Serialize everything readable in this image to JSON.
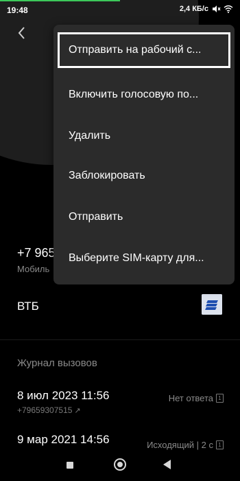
{
  "status_bar": {
    "time": "19:48",
    "speed": "2,4 КБ/с",
    "icons": [
      "mute-icon",
      "wifi-icon"
    ]
  },
  "colors": {
    "background": "#000000",
    "menu_background": "#2b2b2b",
    "accent_green": "#3cc85a",
    "bank_icon": "#1f4fb0"
  },
  "contact": {
    "phone": "+7 965",
    "phone_type": "Мобиль",
    "bank": "ВТБ",
    "bank_icon": "bank-logo-icon"
  },
  "menu": {
    "items": [
      {
        "label": "Отправить на рабочий с..."
      },
      {
        "label": "Включить голосовую по..."
      },
      {
        "label": "Удалить"
      },
      {
        "label": "Заблокировать"
      },
      {
        "label": "Отправить"
      },
      {
        "label": "Выберите SIM-карту для..."
      }
    ]
  },
  "call_history": {
    "title": "Журнал вызовов",
    "rows": [
      {
        "date": "8 июл 2023 11:56",
        "number": "+79659307515",
        "status": "Нет ответа",
        "sim": "1"
      },
      {
        "date": "9 мар 2021 14:56",
        "number": "",
        "status": "Исходящий | 2 с",
        "sim": "1"
      }
    ]
  },
  "nav_bar": {
    "icons": [
      "recents-icon",
      "home-icon",
      "back-icon"
    ]
  }
}
